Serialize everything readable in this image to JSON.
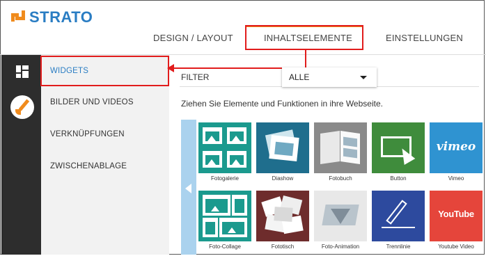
{
  "brand": {
    "name": "STRATO",
    "accent": "#f08b1d",
    "blue": "#2a7dc3"
  },
  "topnav": {
    "tabs": [
      {
        "label": "DESIGN / LAYOUT"
      },
      {
        "label": "INHALTSELEMENTE"
      },
      {
        "label": "EINSTELLUNGEN"
      }
    ],
    "active": "INHALTSELEMENTE"
  },
  "rail": {
    "icons": [
      "layout-grid-icon",
      "paint-brush-icon"
    ]
  },
  "menu": {
    "items": [
      {
        "label": "WIDGETS"
      },
      {
        "label": "BILDER UND VIDEOS"
      },
      {
        "label": "VERKNÜPFUNGEN"
      },
      {
        "label": "ZWISCHENABLAGE"
      }
    ],
    "active": "WIDGETS"
  },
  "filter": {
    "label": "FILTER",
    "selected": "ALLE"
  },
  "hint": "Ziehen Sie Elemente und Funktionen in ihre Webseite.",
  "widgets": [
    {
      "label": "Fotogalerie",
      "icon": "photo-gallery-icon"
    },
    {
      "label": "Diashow",
      "icon": "slideshow-icon"
    },
    {
      "label": "Fotobuch",
      "icon": "photo-book-icon"
    },
    {
      "label": "Button",
      "icon": "button-cursor-icon"
    },
    {
      "label": "Vimeo",
      "icon": "vimeo-icon",
      "logo_text": "vimeo"
    },
    {
      "label": "Foto-Collage",
      "icon": "photo-collage-icon"
    },
    {
      "label": "Fototisch",
      "icon": "photo-table-icon"
    },
    {
      "label": "Foto-Animation",
      "icon": "photo-animation-icon"
    },
    {
      "label": "Trennlinie",
      "icon": "divider-line-icon"
    },
    {
      "label": "Youtube Video",
      "icon": "youtube-icon",
      "logo_text": "YouTube"
    }
  ],
  "annotation_color": "#e11c1c"
}
